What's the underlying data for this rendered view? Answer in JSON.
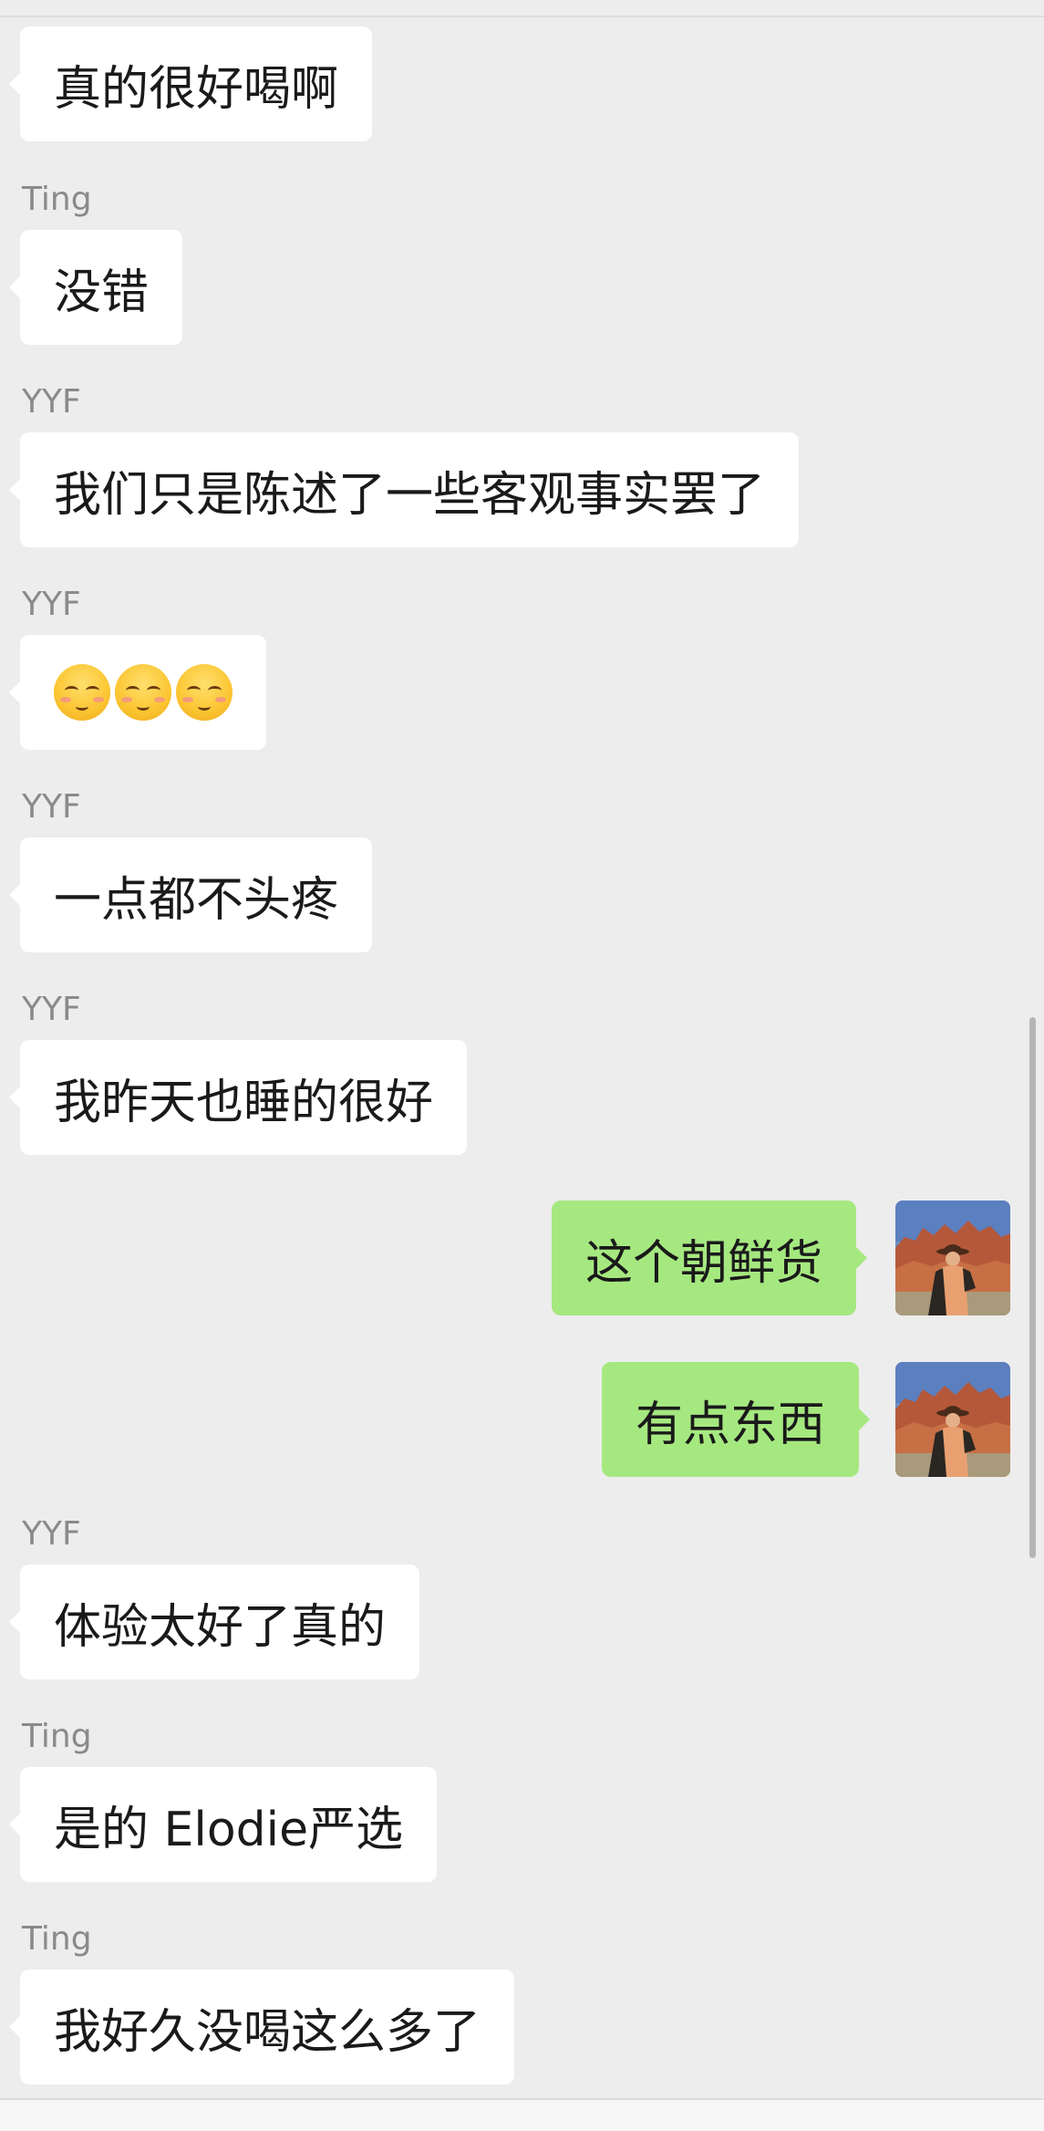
{
  "messages": [
    {
      "sender": "",
      "direction": "in",
      "text": "真的很好喝啊"
    },
    {
      "sender": "Ting",
      "direction": "in",
      "text": "没错"
    },
    {
      "sender": "YYF",
      "direction": "in",
      "text": "我们只是陈述了一些客观事实罢了"
    },
    {
      "sender": "YYF",
      "direction": "in",
      "emoji": [
        "smiling-face-icon",
        "smiling-face-icon",
        "smiling-face-icon"
      ]
    },
    {
      "sender": "YYF",
      "direction": "in",
      "text": "一点都不头疼"
    },
    {
      "sender": "YYF",
      "direction": "in",
      "text": "我昨天也睡的很好"
    },
    {
      "sender": "",
      "direction": "out",
      "text": "这个朝鲜货",
      "avatar": "self-avatar"
    },
    {
      "sender": "",
      "direction": "out",
      "text": "有点东西",
      "avatar": "self-avatar"
    },
    {
      "sender": "YYF",
      "direction": "in",
      "text": "体验太好了真的"
    },
    {
      "sender": "Ting",
      "direction": "in",
      "text": "是的 Elodie严选"
    },
    {
      "sender": "Ting",
      "direction": "in",
      "text": "我好久没喝这么多了"
    }
  ],
  "colors": {
    "background": "#ededed",
    "incoming_bubble": "#ffffff",
    "outgoing_bubble": "#a6e880",
    "sender_name": "#8a8a8a"
  }
}
